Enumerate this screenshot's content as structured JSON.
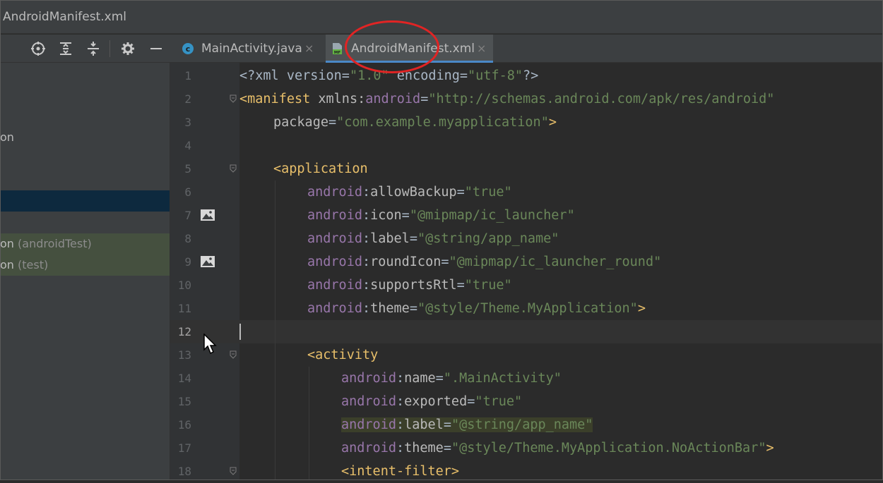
{
  "window": {
    "title": "AndroidManifest.xml"
  },
  "toolbar": {
    "buttons": [
      {
        "name": "locate-icon"
      },
      {
        "name": "expand-all-icon"
      },
      {
        "name": "collapse-all-icon"
      },
      {
        "name": "gear-icon"
      },
      {
        "name": "hide-icon"
      }
    ]
  },
  "project_tree": {
    "rows": [
      {
        "text": "on",
        "suffix": "",
        "state": "normal"
      },
      {
        "text": "",
        "suffix": "",
        "state": "selected"
      },
      {
        "text": "on",
        "suffix": " (androidTest)",
        "state": "green"
      },
      {
        "text": "on",
        "suffix": " (test)",
        "state": "green"
      }
    ]
  },
  "tabs": [
    {
      "label": "MainActivity.java",
      "icon": "java-class-icon",
      "active": false
    },
    {
      "label": "AndroidManifest.xml",
      "icon": "manifest-file-icon",
      "active": true
    }
  ],
  "tab_close_glyph": "×",
  "editor": {
    "current_line": 12,
    "lines": [
      {
        "n": "1",
        "indent": 0,
        "tokens": [
          [
            "p",
            "<?xml version="
          ],
          [
            "val",
            "\"1.0\""
          ],
          [
            "p",
            " encoding="
          ],
          [
            "val",
            "\"utf-8\""
          ],
          [
            "p",
            "?>"
          ]
        ]
      },
      {
        "n": "2",
        "indent": 0,
        "fold": true,
        "tokens": [
          [
            "tag",
            "<manifest "
          ],
          [
            "attr",
            "xmlns:"
          ],
          [
            "ns",
            "android"
          ],
          [
            "p",
            "="
          ],
          [
            "val",
            "\"http://schemas.android.com/apk/res/android\""
          ]
        ]
      },
      {
        "n": "3",
        "indent": 4,
        "tokens": [
          [
            "attr",
            "package"
          ],
          [
            "p",
            "="
          ],
          [
            "val",
            "\"com.example.myapplication\""
          ],
          [
            "tag",
            ">"
          ]
        ]
      },
      {
        "n": "4",
        "indent": 0,
        "tokens": []
      },
      {
        "n": "5",
        "indent": 4,
        "fold": true,
        "tokens": [
          [
            "tag",
            "<application"
          ]
        ]
      },
      {
        "n": "6",
        "indent": 8,
        "tokens": [
          [
            "ns",
            "android"
          ],
          [
            "p",
            ":"
          ],
          [
            "attr",
            "allowBackup"
          ],
          [
            "p",
            "="
          ],
          [
            "val",
            "\"true\""
          ]
        ]
      },
      {
        "n": "7",
        "indent": 8,
        "gutter_icon": "image-icon",
        "tokens": [
          [
            "ns",
            "android"
          ],
          [
            "p",
            ":"
          ],
          [
            "attr",
            "icon"
          ],
          [
            "p",
            "="
          ],
          [
            "val",
            "\"@mipmap/ic_launcher\""
          ]
        ]
      },
      {
        "n": "8",
        "indent": 8,
        "tokens": [
          [
            "ns",
            "android"
          ],
          [
            "p",
            ":"
          ],
          [
            "attr",
            "label"
          ],
          [
            "p",
            "="
          ],
          [
            "val",
            "\"@string/app_name\""
          ]
        ]
      },
      {
        "n": "9",
        "indent": 8,
        "gutter_icon": "image-icon",
        "tokens": [
          [
            "ns",
            "android"
          ],
          [
            "p",
            ":"
          ],
          [
            "attr",
            "roundIcon"
          ],
          [
            "p",
            "="
          ],
          [
            "val",
            "\"@mipmap/ic_launcher_round\""
          ]
        ]
      },
      {
        "n": "10",
        "indent": 8,
        "tokens": [
          [
            "ns",
            "android"
          ],
          [
            "p",
            ":"
          ],
          [
            "attr",
            "supportsRtl"
          ],
          [
            "p",
            "="
          ],
          [
            "val",
            "\"true\""
          ]
        ]
      },
      {
        "n": "11",
        "indent": 8,
        "tokens": [
          [
            "ns",
            "android"
          ],
          [
            "p",
            ":"
          ],
          [
            "attr",
            "theme"
          ],
          [
            "p",
            "="
          ],
          [
            "val",
            "\"@style/Theme.MyApplication\""
          ],
          [
            "tag",
            ">"
          ]
        ]
      },
      {
        "n": "12",
        "indent": 0,
        "tokens": []
      },
      {
        "n": "13",
        "indent": 8,
        "fold": true,
        "tokens": [
          [
            "tag",
            "<activity"
          ]
        ]
      },
      {
        "n": "14",
        "indent": 12,
        "tokens": [
          [
            "ns",
            "android"
          ],
          [
            "p",
            ":"
          ],
          [
            "attr",
            "name"
          ],
          [
            "p",
            "="
          ],
          [
            "val",
            "\".MainActivity\""
          ]
        ]
      },
      {
        "n": "15",
        "indent": 12,
        "tokens": [
          [
            "ns",
            "android"
          ],
          [
            "p",
            ":"
          ],
          [
            "attr",
            "exported"
          ],
          [
            "p",
            "="
          ],
          [
            "val",
            "\"true\""
          ]
        ]
      },
      {
        "n": "16",
        "indent": 12,
        "highlight": true,
        "tokens": [
          [
            "ns",
            "android"
          ],
          [
            "p",
            ":"
          ],
          [
            "attr",
            "label"
          ],
          [
            "p",
            "="
          ],
          [
            "val",
            "\"@string/app_name\""
          ]
        ]
      },
      {
        "n": "17",
        "indent": 12,
        "tokens": [
          [
            "ns",
            "android"
          ],
          [
            "p",
            ":"
          ],
          [
            "attr",
            "theme"
          ],
          [
            "p",
            "="
          ],
          [
            "val",
            "\"@style/Theme.MyApplication.NoActionBar\""
          ],
          [
            "tag",
            ">"
          ]
        ]
      },
      {
        "n": "18",
        "indent": 12,
        "fold": true,
        "tokens": [
          [
            "tag",
            "<intent-filter>"
          ]
        ]
      }
    ]
  },
  "colors": {
    "accent": "#4a88c7",
    "annotation": "#e12424",
    "tag": "#e8bf6a",
    "namespace": "#9876aa",
    "value": "#6a8759"
  }
}
